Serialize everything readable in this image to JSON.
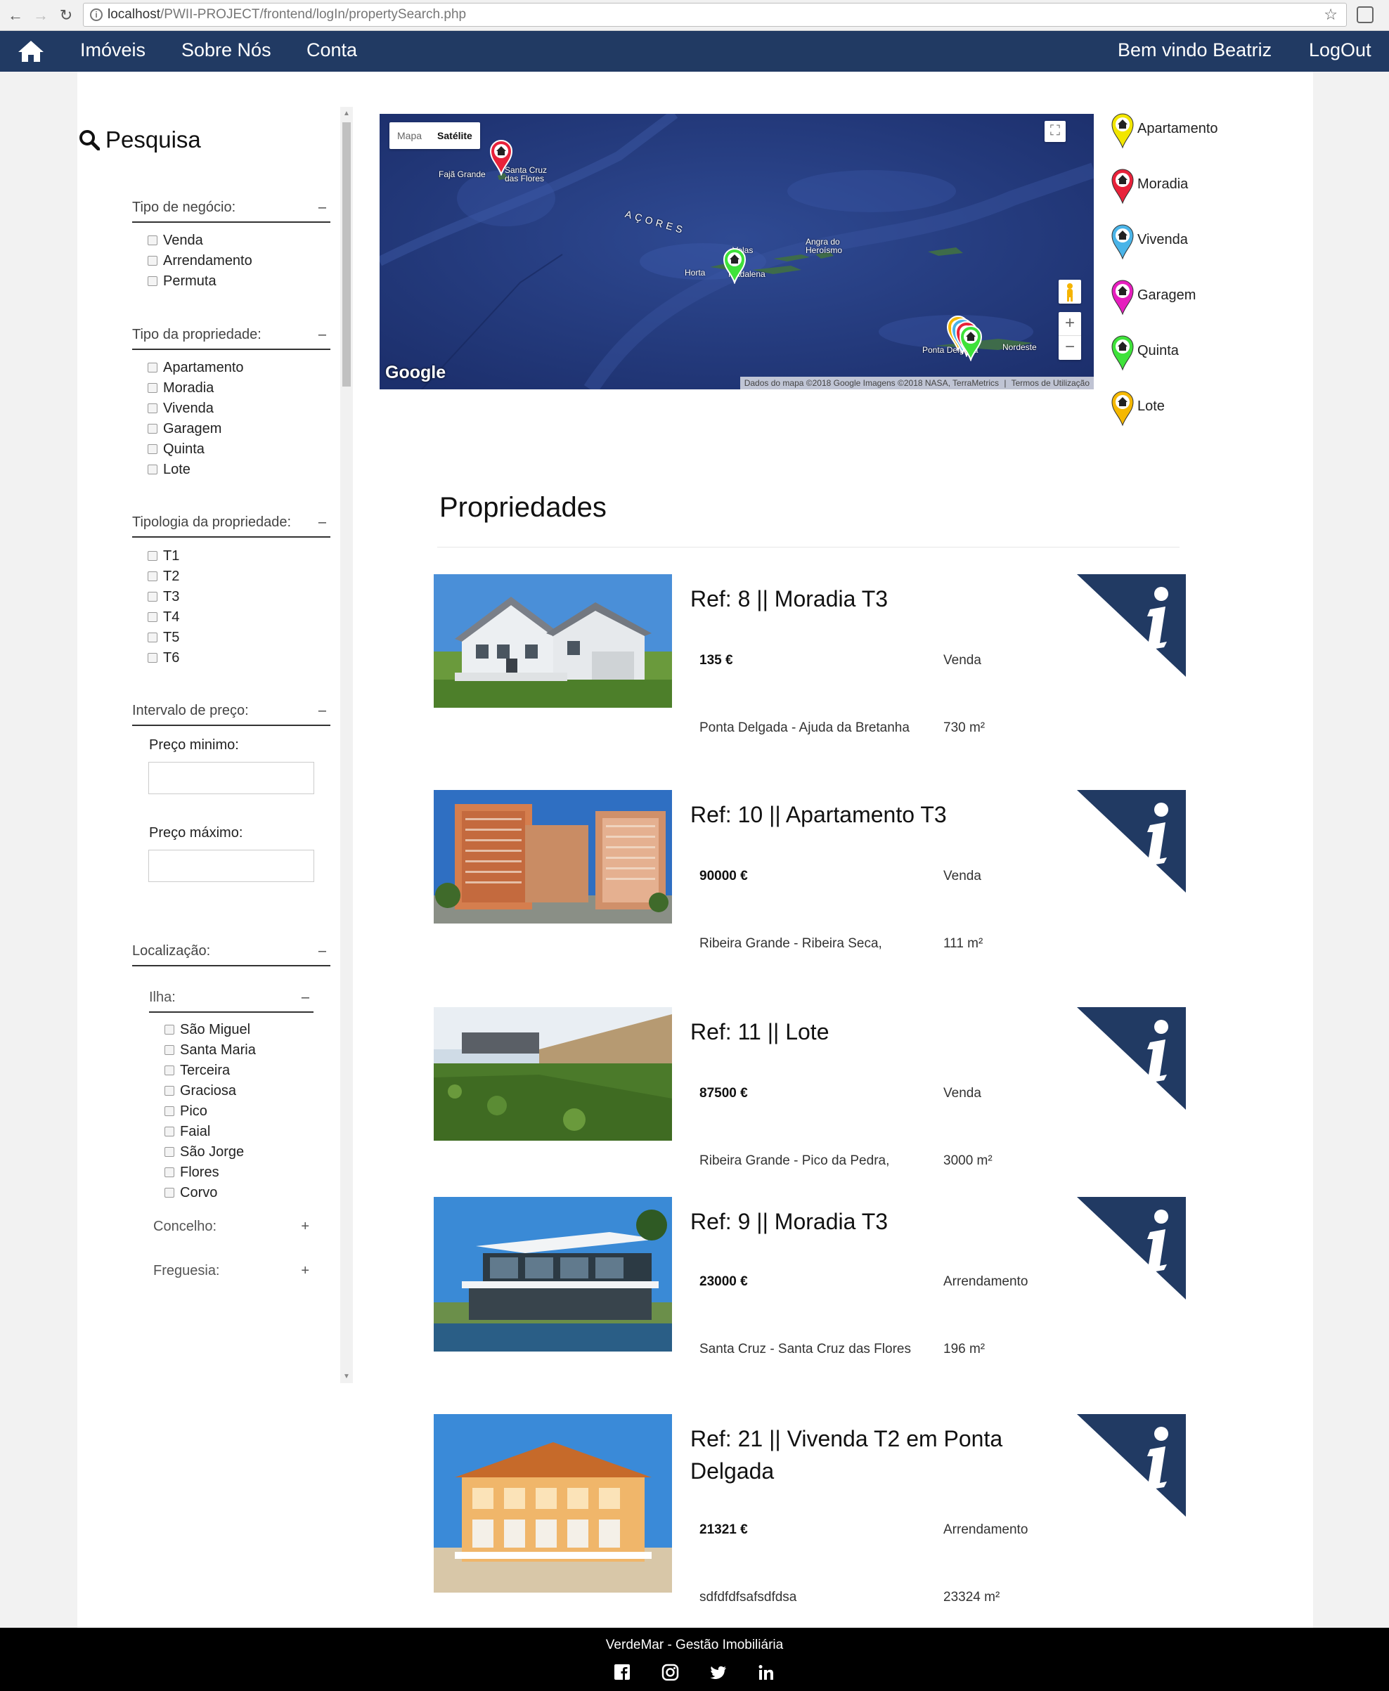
{
  "browser": {
    "url_host": "localhost",
    "url_path": "/PWII-PROJECT/frontend/logIn/propertySearch.php"
  },
  "nav": {
    "items": [
      "Imóveis",
      "Sobre Nós",
      "Conta"
    ],
    "welcome": "Bem vindo Beatriz",
    "logout": "LogOut"
  },
  "sidebar": {
    "title": "Pesquisa",
    "business": {
      "label": "Tipo de negócio:",
      "toggle": "–",
      "options": [
        "Venda",
        "Arrendamento",
        "Permuta"
      ]
    },
    "property_type": {
      "label": "Tipo da propriedade:",
      "toggle": "–",
      "options": [
        "Apartamento",
        "Moradia",
        "Vivenda",
        "Garagem",
        "Quinta",
        "Lote"
      ]
    },
    "typology": {
      "label": "Tipologia da propriedade:",
      "toggle": "–",
      "options": [
        "T1",
        "T2",
        "T3",
        "T4",
        "T5",
        "T6"
      ]
    },
    "price": {
      "label": "Intervalo de preço:",
      "toggle": "–",
      "min_label": "Preço minimo:",
      "max_label": "Preço máximo:",
      "min_value": "",
      "max_value": ""
    },
    "location": {
      "label": "Localização:",
      "toggle": "–",
      "island": {
        "label": "Ilha:",
        "toggle": "–",
        "options": [
          "São Miguel",
          "Santa Maria",
          "Terceira",
          "Graciosa",
          "Pico",
          "Faial",
          "São Jorge",
          "Flores",
          "Corvo"
        ]
      },
      "county": {
        "label": "Concelho:",
        "toggle": "+"
      },
      "parish": {
        "label": "Freguesia:",
        "toggle": "+"
      }
    }
  },
  "map": {
    "type_map": "Mapa",
    "type_satellite": "Satélite",
    "labels": {
      "faja": "Fajã Grande",
      "santa_cruz_1": "Santa Cruz",
      "santa_cruz_2": "das Flores",
      "acores": "AÇORES",
      "velas": "Velas",
      "horta": "Horta",
      "madalena": "Madalena",
      "angra_1": "Angra do",
      "angra_2": "Heroísmo",
      "ponta": "Ponta Delgada",
      "nordeste": "Nordeste"
    },
    "logo": "Google",
    "attribution": "Dados do mapa ©2018 Google Imagens ©2018 NASA, TerraMetrics",
    "terms": "Termos de Utilização",
    "zoom_in": "+",
    "zoom_out": "−"
  },
  "legend": [
    {
      "label": "Apartamento",
      "color": "#f2e600"
    },
    {
      "label": "Moradia",
      "color": "#e8223a"
    },
    {
      "label": "Vivenda",
      "color": "#4ab4e8"
    },
    {
      "label": "Garagem",
      "color": "#e61ebe"
    },
    {
      "label": "Quinta",
      "color": "#3ee23a"
    },
    {
      "label": "Lote",
      "color": "#f5b800"
    }
  ],
  "properties_title": "Propriedades",
  "properties": [
    {
      "ref_label": "Ref: 8",
      "name": "Moradia T3",
      "price": "135 €",
      "business": "Venda",
      "location": "Ponta Delgada - Ajuda da Bretanha",
      "area": "730 m²"
    },
    {
      "ref_label": "Ref: 10",
      "name": "Apartamento T3",
      "price": "90000 €",
      "business": "Venda",
      "location": "Ribeira Grande - Ribeira Seca,",
      "area": "111 m²"
    },
    {
      "ref_label": "Ref: 11",
      "name": "Lote",
      "price": "87500 €",
      "business": "Venda",
      "location": "Ribeira Grande - Pico da Pedra,",
      "area": "3000 m²"
    },
    {
      "ref_label": "Ref: 9",
      "name": "Moradia T3",
      "price": "23000 €",
      "business": "Arrendamento",
      "location": "Santa Cruz - Santa Cruz das Flores",
      "area": "196 m²"
    },
    {
      "ref_label": "Ref: 21",
      "name": "Vivenda T2 em Ponta Delgada",
      "price": "21321 €",
      "business": "Arrendamento",
      "location": "sdfdfdfsafsdfdsa",
      "area": "23324 m²"
    }
  ],
  "footer": {
    "text": "VerdeMar - Gestão Imobiliária"
  },
  "colors": {
    "navbar": "#213a63",
    "info_triangle": "#213a63",
    "footer": "#000000"
  }
}
